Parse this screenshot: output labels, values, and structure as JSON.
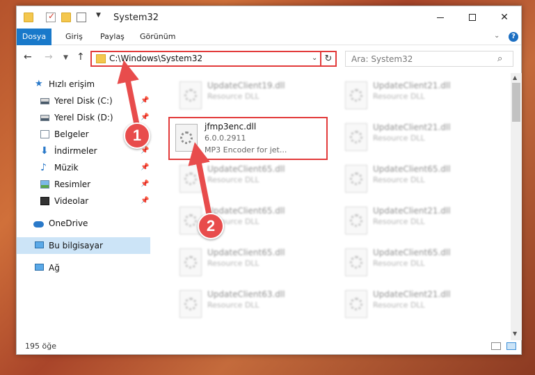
{
  "window": {
    "title": "System32",
    "minimize_label": "",
    "maximize_label": "",
    "close_label": "✕"
  },
  "ribbon": {
    "tabs": [
      "Dosya",
      "Giriş",
      "Paylaş",
      "Görünüm"
    ],
    "help_label": "?"
  },
  "navigation": {
    "address": "C:\\Windows\\System32",
    "search_placeholder": "Ara: System32"
  },
  "sidebar": {
    "items": [
      {
        "label": "Hızlı erişim",
        "icon": "star-icon",
        "pinned": false
      },
      {
        "label": "Yerel Disk (C:)",
        "icon": "drive-icon",
        "pinned": true
      },
      {
        "label": "Yerel Disk (D:)",
        "icon": "drive-icon",
        "pinned": true
      },
      {
        "label": "Belgeler",
        "icon": "documents-icon",
        "pinned": true
      },
      {
        "label": "İndirmeler",
        "icon": "download-icon",
        "pinned": true
      },
      {
        "label": "Müzik",
        "icon": "music-icon",
        "pinned": true
      },
      {
        "label": "Resimler",
        "icon": "pictures-icon",
        "pinned": true
      },
      {
        "label": "Videolar",
        "icon": "videos-icon",
        "pinned": true
      },
      {
        "label": "OneDrive",
        "icon": "onedrive-icon",
        "pinned": false
      },
      {
        "label": "Bu bilgisayar",
        "icon": "computer-icon",
        "pinned": false,
        "selected": true
      },
      {
        "label": "Ağ",
        "icon": "network-icon",
        "pinned": false
      }
    ]
  },
  "files": {
    "highlighted": {
      "name": "jfmp3enc.dll",
      "version": "6.0.0.2911",
      "description": "MP3 Encoder for jet..."
    },
    "background": [
      {
        "name": "UpdateClient19.dll",
        "type": "Resource DLL"
      },
      {
        "name": "UpdateClient21.dll",
        "type": "Resource DLL"
      },
      {
        "name": "UpdateClient21.dll",
        "type": "Resource DLL"
      },
      {
        "name": "UpdateClient65.dll",
        "type": "Resource DLL"
      },
      {
        "name": "UpdateClient65.dll",
        "type": "Resource DLL"
      },
      {
        "name": "UpdateClient65.dll",
        "type": "Resource DLL"
      },
      {
        "name": "UpdateClient21.dll",
        "type": "Resource DLL"
      },
      {
        "name": "UpdateClient65.dll",
        "type": "Resource DLL"
      },
      {
        "name": "UpdateClient65.dll",
        "type": "Resource DLL"
      },
      {
        "name": "UpdateClient63.dll",
        "type": "Resource DLL"
      },
      {
        "name": "UpdateClient21.dll",
        "type": "Resource DLL"
      }
    ]
  },
  "status": {
    "item_count": "195 öğe"
  },
  "annotations": {
    "step1": "1",
    "step2": "2",
    "color": "#e84c4c"
  }
}
